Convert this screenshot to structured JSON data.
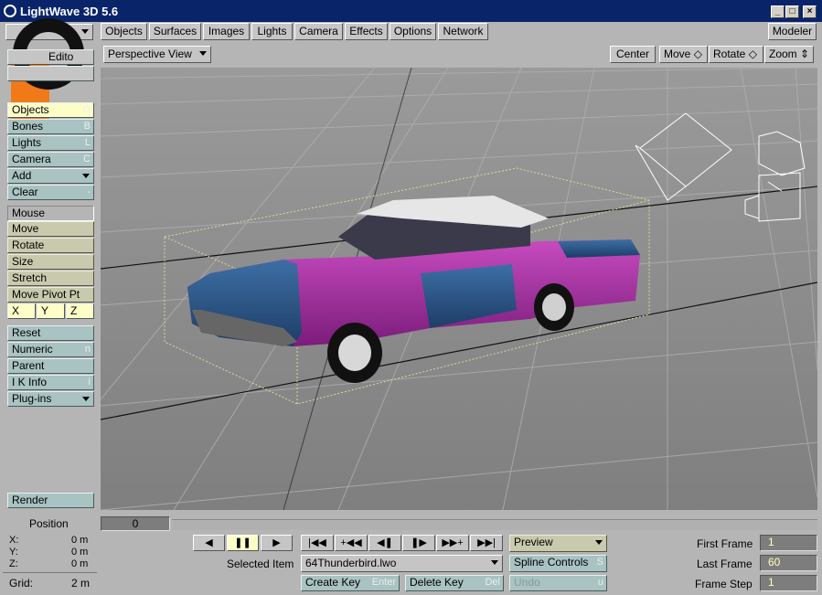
{
  "window": {
    "title": "LightWave 3D 5.6",
    "min": "_",
    "max": "□",
    "close": "×"
  },
  "menu": {
    "tabs": [
      "Objects",
      "Surfaces",
      "Images",
      "Lights",
      "Camera",
      "Effects",
      "Options",
      "Network"
    ],
    "modeler": "Modeler"
  },
  "sidebar": {
    "top1": "Edito",
    "top2": "",
    "items_a": [
      {
        "label": "Objects",
        "key": "O"
      },
      {
        "label": "Bones",
        "key": "B"
      },
      {
        "label": "Lights",
        "key": "L"
      },
      {
        "label": "Camera",
        "key": "C"
      },
      {
        "label": "Add",
        "key": ""
      },
      {
        "label": "Clear",
        "key": "-"
      }
    ],
    "mouse": "Mouse",
    "items_b": [
      {
        "label": "Move"
      },
      {
        "label": "Rotate"
      },
      {
        "label": "Size"
      },
      {
        "label": "Stretch"
      },
      {
        "label": "Move Pivot Pt"
      }
    ],
    "axes": [
      "X",
      "Y",
      "Z"
    ],
    "items_c": [
      {
        "label": "Reset",
        "key": ""
      },
      {
        "label": "Numeric",
        "key": "n"
      },
      {
        "label": "Parent",
        "key": ""
      },
      {
        "label": "I K Info",
        "key": "i"
      },
      {
        "label": "Plug-ins",
        "key": ""
      }
    ],
    "render": "Render"
  },
  "viewport": {
    "view_mode": "Perspective View",
    "center": "Center",
    "move": "Move",
    "rotate": "Rotate",
    "zoom": "Zoom"
  },
  "position": {
    "title": "Position",
    "x_label": "X:",
    "x_value": "0 m",
    "y_label": "Y:",
    "y_value": "0 m",
    "z_label": "Z:",
    "z_value": "0 m",
    "grid_label": "Grid:",
    "grid_value": "2 m"
  },
  "timeline": {
    "frame": "0",
    "selected_item_label": "Selected Item",
    "selected_item": "64Thunderbird.lwo",
    "create_key": "Create Key",
    "create_key_hint": "Enter",
    "delete_key": "Delete Key",
    "delete_key_hint": "Del",
    "preview": "Preview",
    "spline_controls": "Spline Controls",
    "spline_hint": "S",
    "undo": "Undo",
    "undo_hint": "u",
    "first_frame_label": "First Frame",
    "first_frame": "1",
    "last_frame_label": "Last Frame",
    "last_frame": "60",
    "frame_step_label": "Frame Step",
    "frame_step": "1"
  }
}
